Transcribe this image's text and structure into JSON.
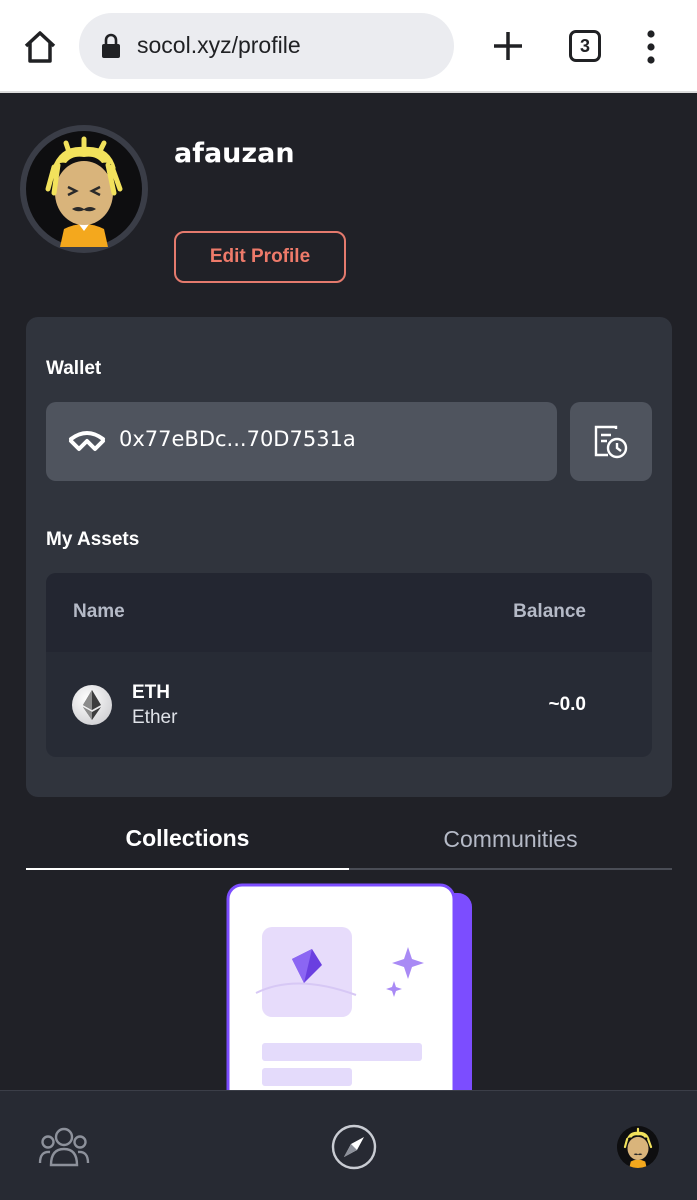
{
  "browser": {
    "url": "socol.xyz/profile",
    "tab_count": "3"
  },
  "profile": {
    "username": "afauzan",
    "edit_label": "Edit Profile"
  },
  "wallet": {
    "label": "Wallet",
    "address": "0x77eBDc...70D7531a"
  },
  "assets": {
    "label": "My Assets",
    "columns": [
      "Name",
      "Balance"
    ],
    "rows": [
      {
        "symbol": "ETH",
        "name": "Ether",
        "balance": "~0.0"
      }
    ]
  },
  "tabs": [
    {
      "label": "Collections",
      "active": true
    },
    {
      "label": "Communities",
      "active": false
    }
  ],
  "colors": {
    "accent": "#ee7a6a",
    "background": "#202127",
    "card": "#30343d",
    "illustration_purple": "#7c4dff"
  }
}
